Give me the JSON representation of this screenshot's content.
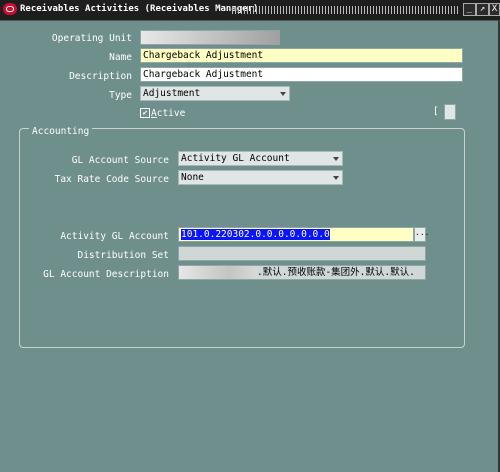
{
  "window": {
    "title": "Receivables Activities (Receivables Manager)",
    "controls": [
      "_",
      "↗",
      "X"
    ]
  },
  "form": {
    "operating_unit_label": "Operating Unit",
    "name_label": "Name",
    "name_value": "Chargeback Adjustment",
    "description_label": "Description",
    "description_value": "Chargeback Adjustment",
    "type_label": "Type",
    "type_value": "Adjustment",
    "active_label": "Active",
    "active_mnemonic": "A",
    "active_rest": "ctive",
    "active_checked": true,
    "bracket_text": "["
  },
  "accounting": {
    "group_label": "Accounting",
    "gl_account_source_label": "GL Account Source",
    "gl_account_source_value": "Activity GL Account",
    "tax_rate_code_source_label": "Tax Rate Code Source",
    "tax_rate_code_source_value": "None",
    "activity_gl_account_label": "Activity GL Account",
    "activity_gl_account_value": "101.0.220302.0.0.0.0.0.0.0",
    "lov_button": "...",
    "distribution_set_label": "Distribution Set",
    "distribution_set_value": "",
    "gl_account_description_label": "GL Account Description",
    "gl_account_description_value": ".默认.预收账款-集团外.默认.默认."
  },
  "colors": {
    "background": "#6f8f8c",
    "required_field": "#ffffc4",
    "selection": "#0a14ff",
    "titlebar": "#1e1e1e"
  }
}
